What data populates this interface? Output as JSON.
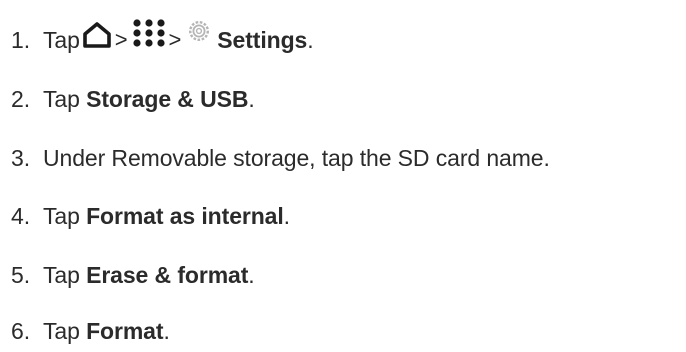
{
  "steps": [
    {
      "number": "1.",
      "lead": "Tap",
      "separator_1": ">",
      "separator_2": ">",
      "bold": "Settings",
      "trail": ".",
      "icons": [
        "home-icon",
        "apps-icon",
        "gear-icon"
      ]
    },
    {
      "number": "2.",
      "lead": "Tap ",
      "bold": "Storage & USB",
      "trail": "."
    },
    {
      "number": "3.",
      "text": "Under Removable storage, tap the SD card name."
    },
    {
      "number": "4.",
      "lead": "Tap ",
      "bold": "Format as internal",
      "trail": "."
    },
    {
      "number": "5.",
      "lead": "Tap ",
      "bold": "Erase & format",
      "trail": "."
    },
    {
      "number": "6.",
      "lead": "Tap ",
      "bold": "Format",
      "trail": "."
    }
  ],
  "colors": {
    "text": "#2b2b2b",
    "icon": "#1a1a1a",
    "gear": "#b5b5b5"
  }
}
